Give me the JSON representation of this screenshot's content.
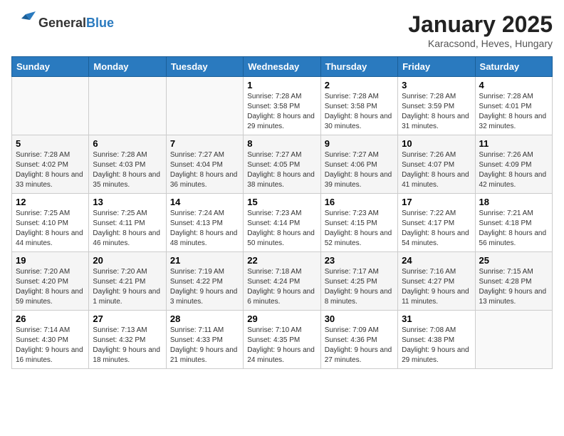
{
  "header": {
    "logo_general": "General",
    "logo_blue": "Blue",
    "title": "January 2025",
    "subtitle": "Karacsond, Heves, Hungary"
  },
  "weekdays": [
    "Sunday",
    "Monday",
    "Tuesday",
    "Wednesday",
    "Thursday",
    "Friday",
    "Saturday"
  ],
  "weeks": [
    [
      {
        "day": "",
        "info": ""
      },
      {
        "day": "",
        "info": ""
      },
      {
        "day": "",
        "info": ""
      },
      {
        "day": "1",
        "info": "Sunrise: 7:28 AM\nSunset: 3:58 PM\nDaylight: 8 hours and 29 minutes."
      },
      {
        "day": "2",
        "info": "Sunrise: 7:28 AM\nSunset: 3:58 PM\nDaylight: 8 hours and 30 minutes."
      },
      {
        "day": "3",
        "info": "Sunrise: 7:28 AM\nSunset: 3:59 PM\nDaylight: 8 hours and 31 minutes."
      },
      {
        "day": "4",
        "info": "Sunrise: 7:28 AM\nSunset: 4:01 PM\nDaylight: 8 hours and 32 minutes."
      }
    ],
    [
      {
        "day": "5",
        "info": "Sunrise: 7:28 AM\nSunset: 4:02 PM\nDaylight: 8 hours and 33 minutes."
      },
      {
        "day": "6",
        "info": "Sunrise: 7:28 AM\nSunset: 4:03 PM\nDaylight: 8 hours and 35 minutes."
      },
      {
        "day": "7",
        "info": "Sunrise: 7:27 AM\nSunset: 4:04 PM\nDaylight: 8 hours and 36 minutes."
      },
      {
        "day": "8",
        "info": "Sunrise: 7:27 AM\nSunset: 4:05 PM\nDaylight: 8 hours and 38 minutes."
      },
      {
        "day": "9",
        "info": "Sunrise: 7:27 AM\nSunset: 4:06 PM\nDaylight: 8 hours and 39 minutes."
      },
      {
        "day": "10",
        "info": "Sunrise: 7:26 AM\nSunset: 4:07 PM\nDaylight: 8 hours and 41 minutes."
      },
      {
        "day": "11",
        "info": "Sunrise: 7:26 AM\nSunset: 4:09 PM\nDaylight: 8 hours and 42 minutes."
      }
    ],
    [
      {
        "day": "12",
        "info": "Sunrise: 7:25 AM\nSunset: 4:10 PM\nDaylight: 8 hours and 44 minutes."
      },
      {
        "day": "13",
        "info": "Sunrise: 7:25 AM\nSunset: 4:11 PM\nDaylight: 8 hours and 46 minutes."
      },
      {
        "day": "14",
        "info": "Sunrise: 7:24 AM\nSunset: 4:13 PM\nDaylight: 8 hours and 48 minutes."
      },
      {
        "day": "15",
        "info": "Sunrise: 7:23 AM\nSunset: 4:14 PM\nDaylight: 8 hours and 50 minutes."
      },
      {
        "day": "16",
        "info": "Sunrise: 7:23 AM\nSunset: 4:15 PM\nDaylight: 8 hours and 52 minutes."
      },
      {
        "day": "17",
        "info": "Sunrise: 7:22 AM\nSunset: 4:17 PM\nDaylight: 8 hours and 54 minutes."
      },
      {
        "day": "18",
        "info": "Sunrise: 7:21 AM\nSunset: 4:18 PM\nDaylight: 8 hours and 56 minutes."
      }
    ],
    [
      {
        "day": "19",
        "info": "Sunrise: 7:20 AM\nSunset: 4:20 PM\nDaylight: 8 hours and 59 minutes."
      },
      {
        "day": "20",
        "info": "Sunrise: 7:20 AM\nSunset: 4:21 PM\nDaylight: 9 hours and 1 minute."
      },
      {
        "day": "21",
        "info": "Sunrise: 7:19 AM\nSunset: 4:22 PM\nDaylight: 9 hours and 3 minutes."
      },
      {
        "day": "22",
        "info": "Sunrise: 7:18 AM\nSunset: 4:24 PM\nDaylight: 9 hours and 6 minutes."
      },
      {
        "day": "23",
        "info": "Sunrise: 7:17 AM\nSunset: 4:25 PM\nDaylight: 9 hours and 8 minutes."
      },
      {
        "day": "24",
        "info": "Sunrise: 7:16 AM\nSunset: 4:27 PM\nDaylight: 9 hours and 11 minutes."
      },
      {
        "day": "25",
        "info": "Sunrise: 7:15 AM\nSunset: 4:28 PM\nDaylight: 9 hours and 13 minutes."
      }
    ],
    [
      {
        "day": "26",
        "info": "Sunrise: 7:14 AM\nSunset: 4:30 PM\nDaylight: 9 hours and 16 minutes."
      },
      {
        "day": "27",
        "info": "Sunrise: 7:13 AM\nSunset: 4:32 PM\nDaylight: 9 hours and 18 minutes."
      },
      {
        "day": "28",
        "info": "Sunrise: 7:11 AM\nSunset: 4:33 PM\nDaylight: 9 hours and 21 minutes."
      },
      {
        "day": "29",
        "info": "Sunrise: 7:10 AM\nSunset: 4:35 PM\nDaylight: 9 hours and 24 minutes."
      },
      {
        "day": "30",
        "info": "Sunrise: 7:09 AM\nSunset: 4:36 PM\nDaylight: 9 hours and 27 minutes."
      },
      {
        "day": "31",
        "info": "Sunrise: 7:08 AM\nSunset: 4:38 PM\nDaylight: 9 hours and 29 minutes."
      },
      {
        "day": "",
        "info": ""
      }
    ]
  ]
}
